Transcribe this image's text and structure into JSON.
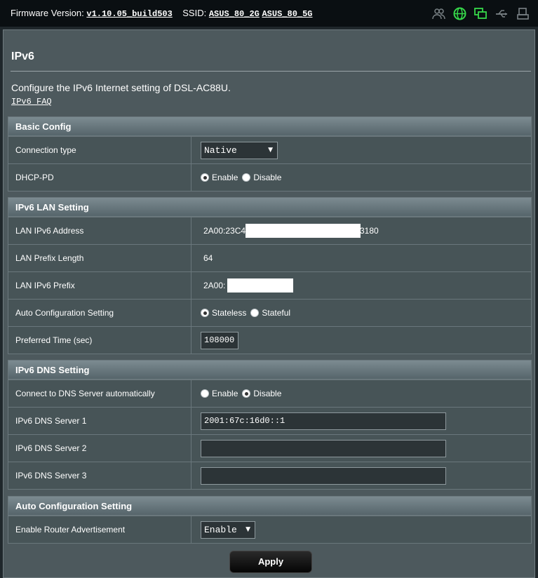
{
  "topbar": {
    "firmware_label": "Firmware Version:",
    "firmware_value": "v1.10.05_build503",
    "ssid_label": "SSID:",
    "ssid_2g": "ASUS_80_2G",
    "ssid_5g": "ASUS_80_5G",
    "icons": [
      "clients-icon",
      "internet-globe-icon",
      "wireless-icon",
      "usb-icon",
      "printer-icon"
    ]
  },
  "page": {
    "title": "IPv6",
    "description": "Configure the IPv6 Internet setting of DSL-AC88U.",
    "faq_link": "IPv6 FAQ"
  },
  "basic": {
    "header": "Basic Config",
    "connection_type_label": "Connection type",
    "connection_type_value": "Native",
    "dhcp_pd_label": "DHCP-PD",
    "enable": "Enable",
    "disable": "Disable",
    "dhcp_pd_selected": "Enable"
  },
  "lan": {
    "header": "IPv6 LAN Setting",
    "address_label": "LAN IPv6 Address",
    "address_prefix": "2A00:23C4",
    "address_suffix": "3180",
    "prefix_length_label": "LAN Prefix Length",
    "prefix_length_value": "64",
    "prefix_label": "LAN IPv6 Prefix",
    "prefix_value": "2A00:",
    "autoconf_label": "Auto Configuration Setting",
    "stateless": "Stateless",
    "stateful": "Stateful",
    "preferred_label": "Preferred Time (sec)",
    "preferred_value": "108000"
  },
  "dns": {
    "header": "IPv6 DNS Setting",
    "auto_label": "Connect to DNS Server automatically",
    "enable": "Enable",
    "disable": "Disable",
    "server1_label": "IPv6 DNS Server 1",
    "server1_value": "2001:67c:16d0::1",
    "server2_label": "IPv6 DNS Server 2",
    "server2_value": "",
    "server3_label": "IPv6 DNS Server 3",
    "server3_value": ""
  },
  "autoconf": {
    "header": "Auto Configuration Setting",
    "ra_label": "Enable Router Advertisement",
    "ra_value": "Enable"
  },
  "apply_label": "Apply"
}
